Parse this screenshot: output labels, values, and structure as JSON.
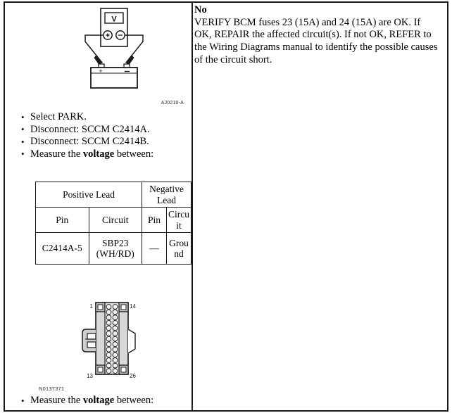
{
  "document": {
    "type": "automotive-service-diagnostic-step",
    "layout": "two-column"
  },
  "left_column": {
    "voltmeter_figure": {
      "figure_id": "AJ0210-A",
      "meter_display_label": "V",
      "meter_positive_jack": "+",
      "meter_negative_jack": "−",
      "battery_positive_terminal": "+",
      "battery_negative_terminal": "−",
      "description": "Voltmeter connected across battery terminals with test leads"
    },
    "steps_top": [
      {
        "text": "Select PARK.",
        "bold": ""
      },
      {
        "text": "Disconnect: SCCM C2414A.",
        "bold": ""
      },
      {
        "text": "Disconnect: SCCM C2414B.",
        "bold": ""
      },
      {
        "prefix": "Measure the ",
        "bold": "voltage",
        "suffix": " between:"
      }
    ],
    "measurement_table": {
      "group_headers": [
        "Positive Lead",
        "Negative Lead"
      ],
      "sub_headers": [
        "Pin",
        "Circuit",
        "Pin",
        "Circuit"
      ],
      "rows": [
        {
          "positive_pin": "C2414A-5",
          "positive_circuit": "SBP23 (WH/RD)",
          "negative_pin": "—",
          "negative_circuit": "Ground"
        }
      ]
    },
    "connector_figure": {
      "part_id": "N0137371",
      "pin_labels": {
        "top_left": "1",
        "top_right": "14",
        "bottom_left": "13",
        "bottom_right": "26"
      },
      "pin_count": 26,
      "rows": 13,
      "columns": 2,
      "description": "26-pin connector face view with side latch"
    },
    "steps_bottom": [
      {
        "prefix": "Measure the ",
        "bold": "voltage",
        "suffix": " between:"
      }
    ]
  },
  "right_column": {
    "answer_label": "No",
    "answer_body": "VERIFY BCM fuses 23 (15A) and 24 (15A) are OK. If OK, REPAIR the affected circuit(s). If not OK, REFER to the Wiring Diagrams manual to identify the possible causes of the circuit short."
  },
  "colors": {
    "border": "#1a1a1a",
    "text": "#000000",
    "figure_caption": "#2b2b2b",
    "connector_fill": "#d8d8d8",
    "connector_shade": "#a8a8a8",
    "page_background": "#ffffff"
  }
}
